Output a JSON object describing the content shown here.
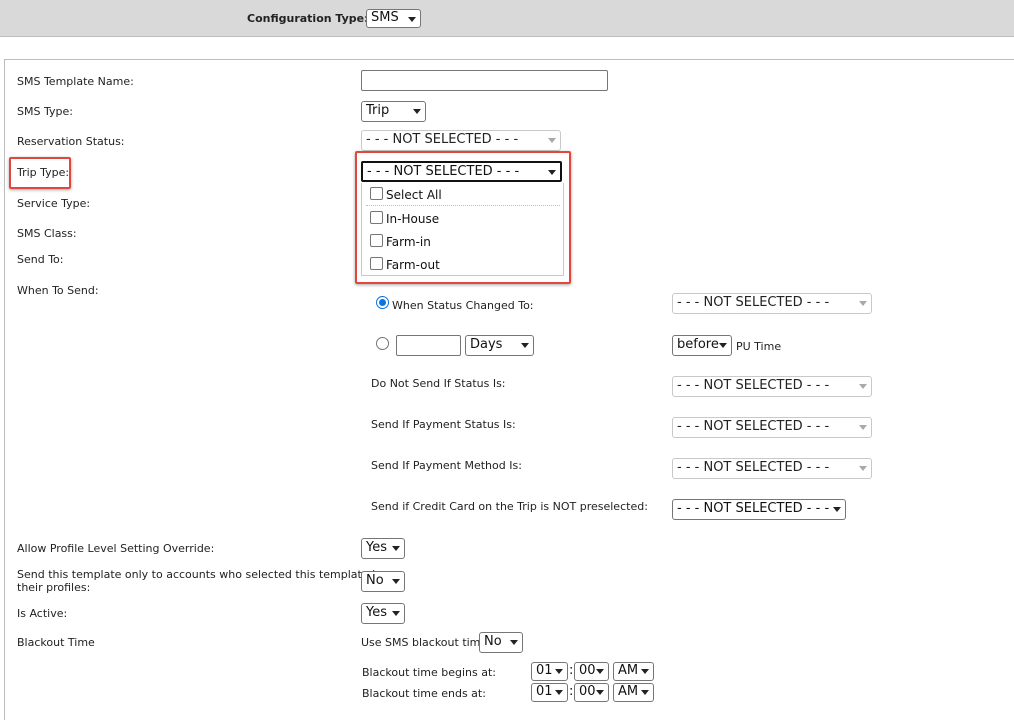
{
  "header": {
    "config_type_label": "Configuration Type:",
    "config_type_value": "SMS"
  },
  "form": {
    "template_name_label": "SMS Template Name:",
    "template_name_value": "",
    "sms_type_label": "SMS Type:",
    "sms_type_value": "Trip",
    "reservation_status_label": "Reservation Status:",
    "reservation_status_value": "- - - NOT SELECTED - - -",
    "trip_type_label": "Trip Type:",
    "trip_type_value": "- - - NOT SELECTED - - -",
    "service_type_label": "Service Type:",
    "sms_class_label": "SMS Class:",
    "send_to_label": "Send To:",
    "when_to_send_label": "When To Send:"
  },
  "trip_type_dropdown": {
    "options": [
      {
        "label": "Select All",
        "checked": false
      },
      {
        "label": "In-House",
        "checked": false
      },
      {
        "label": "Farm-in",
        "checked": false
      },
      {
        "label": "Farm-out",
        "checked": false
      }
    ]
  },
  "when_to_send": {
    "status_changed_label": "When Status Changed To:",
    "status_changed_radio_selected": true,
    "status_changed_value": "- - - NOT SELECTED - - -",
    "days_radio_selected": false,
    "days_input_value": "",
    "days_unit_value": "Days",
    "before_value": "before",
    "pu_time_label": "PU Time",
    "do_not_send_label": "Do Not Send If Status Is:",
    "do_not_send_value": "- - - NOT SELECTED - - -",
    "payment_status_label": "Send If Payment Status Is:",
    "payment_status_value": "- - - NOT SELECTED - - -",
    "payment_method_label": "Send If Payment Method Is:",
    "payment_method_value": "- - - NOT SELECTED - - -",
    "credit_card_label": "Send if Credit Card on the Trip is NOT preselected:",
    "credit_card_value": "- - - NOT SELECTED - - -"
  },
  "settings": {
    "allow_override_label": "Allow Profile Level Setting Override:",
    "allow_override_value": "Yes",
    "send_only_label_line1": "Send this template only to accounts who selected this template in",
    "send_only_label_line2": "their profiles:",
    "send_only_value": "No",
    "is_active_label": "Is Active:",
    "is_active_value": "Yes",
    "blackout_time_label": "Blackout Time",
    "use_blackout_label": "Use SMS blackout time:",
    "use_blackout_value": "No",
    "begins_label": "Blackout time begins at:",
    "begins_hour": "01",
    "begins_minute": "00",
    "begins_ampm": "AM",
    "ends_label": "Blackout time ends at:",
    "ends_hour": "01",
    "ends_minute": "00",
    "ends_ampm": "AM",
    "time_separator": ":"
  },
  "colors": {
    "highlight": "#e2473d",
    "radio_accent": "#0b74de",
    "header_bg": "#d9d9d9"
  }
}
